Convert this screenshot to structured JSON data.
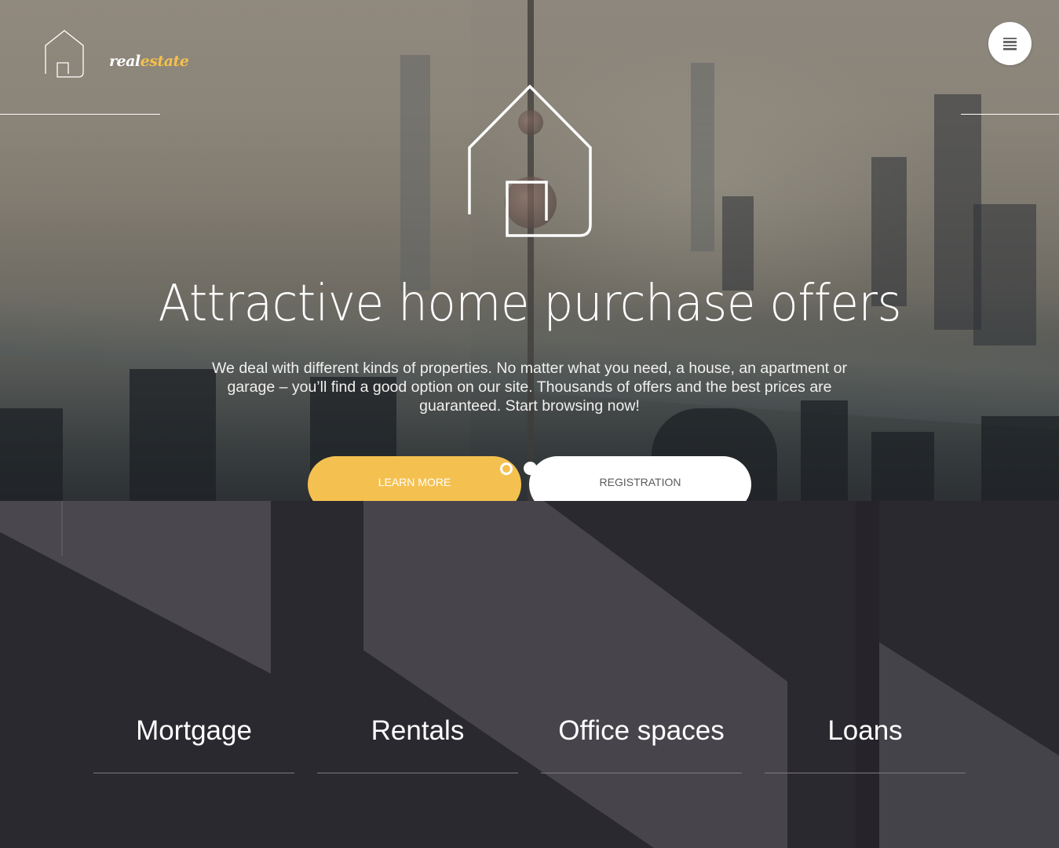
{
  "brand": {
    "logo_icon": "house-outline-icon",
    "name_part1": "real",
    "name_part2": "estate",
    "accent_color": "#f4c150"
  },
  "header": {
    "menu_icon": "hamburger-menu-icon"
  },
  "hero": {
    "emblem_icon": "house-outline-icon",
    "title": "Attractive home purchase offers",
    "description": "We deal with different kinds of properties. No matter what you need, a house, an apartment or garage – you’ll find a good option on our site. Thousands of offers and the best prices are guaranteed. Start browsing now!",
    "buttons": {
      "learn_more": "LEARN MORE",
      "registration": "REGISTRATION"
    },
    "slider": {
      "total": 2,
      "active": 1
    }
  },
  "services": {
    "items": [
      {
        "label": "Mortgage"
      },
      {
        "label": "Rentals"
      },
      {
        "label": "Office spaces"
      },
      {
        "label": "Loans"
      }
    ]
  },
  "colors": {
    "primary_button": "#f4c150",
    "secondary_button": "#ffffff",
    "dark_section": "#2b2930"
  }
}
